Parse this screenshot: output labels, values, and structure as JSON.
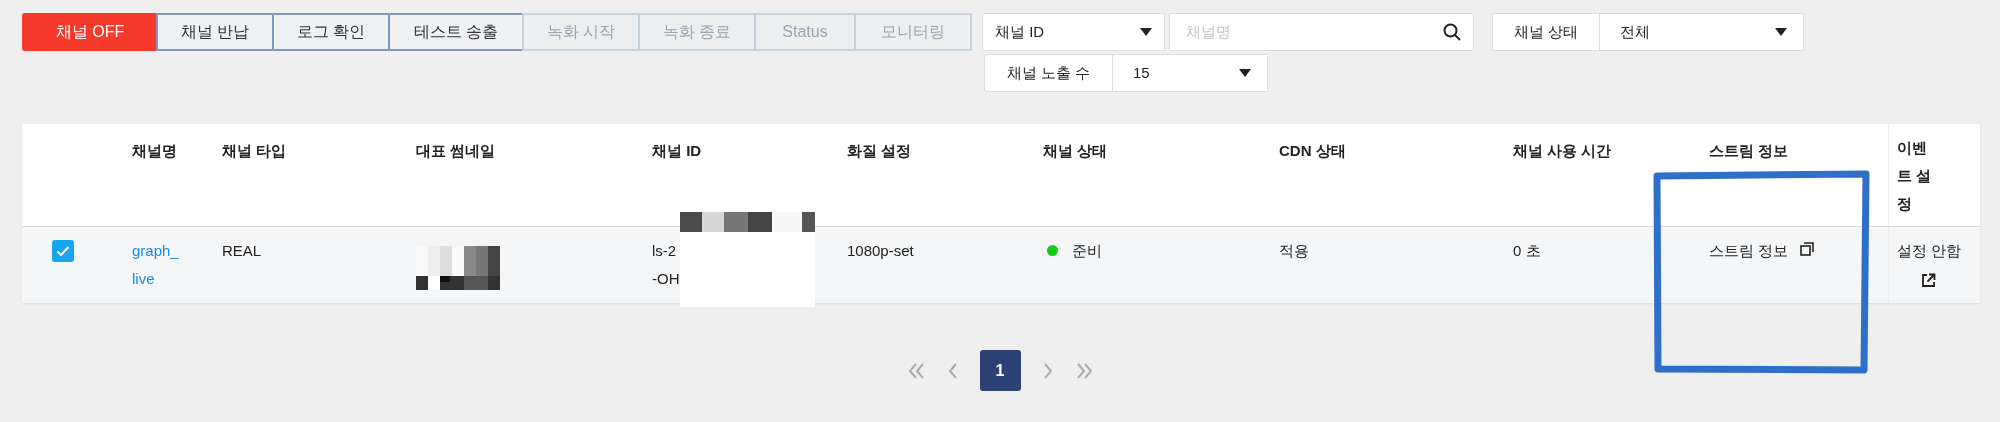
{
  "toolbar": {
    "buttons": [
      {
        "label": "채널 OFF",
        "kind": "danger",
        "disabled": false
      },
      {
        "label": "채널 반납",
        "kind": "outline",
        "disabled": false
      },
      {
        "label": "로그 확인",
        "kind": "outline",
        "disabled": false
      },
      {
        "label": "테스트 송출",
        "kind": "outline",
        "disabled": false
      },
      {
        "label": "녹화 시작",
        "kind": "outline",
        "disabled": true
      },
      {
        "label": "녹화 종료",
        "kind": "outline",
        "disabled": true
      },
      {
        "label": "Status",
        "kind": "outline",
        "disabled": true
      },
      {
        "label": "모니터링",
        "kind": "outline",
        "disabled": true
      }
    ]
  },
  "filters": {
    "search_type": {
      "value": "채널 ID"
    },
    "search": {
      "placeholder": "채널명"
    },
    "status": {
      "label": "채널 상태",
      "value": "전체"
    },
    "page_size": {
      "label": "채널 노출 수",
      "value": "15"
    }
  },
  "table": {
    "columns": [
      "채널명",
      "채널 타입",
      "대표 썸네일",
      "채널 ID",
      "화질 설정",
      "채널 상태",
      "CDN 상태",
      "채널 사용 시간",
      "스트림 정보",
      "이벤트 설정"
    ],
    "rows": [
      {
        "checked": true,
        "name": "graph_live",
        "type": "REAL",
        "channel_id": [
          "ls-2",
          "-OH"
        ],
        "quality": "1080p-set",
        "status": "준비",
        "color": "#11cc11",
        "cdn": "적용",
        "usage_time": "0 초",
        "stream_info": "스트림 정보",
        "event": "설정 안함"
      }
    ]
  },
  "pagination": {
    "pages": [
      {
        "label": "1",
        "selected": true
      }
    ]
  }
}
